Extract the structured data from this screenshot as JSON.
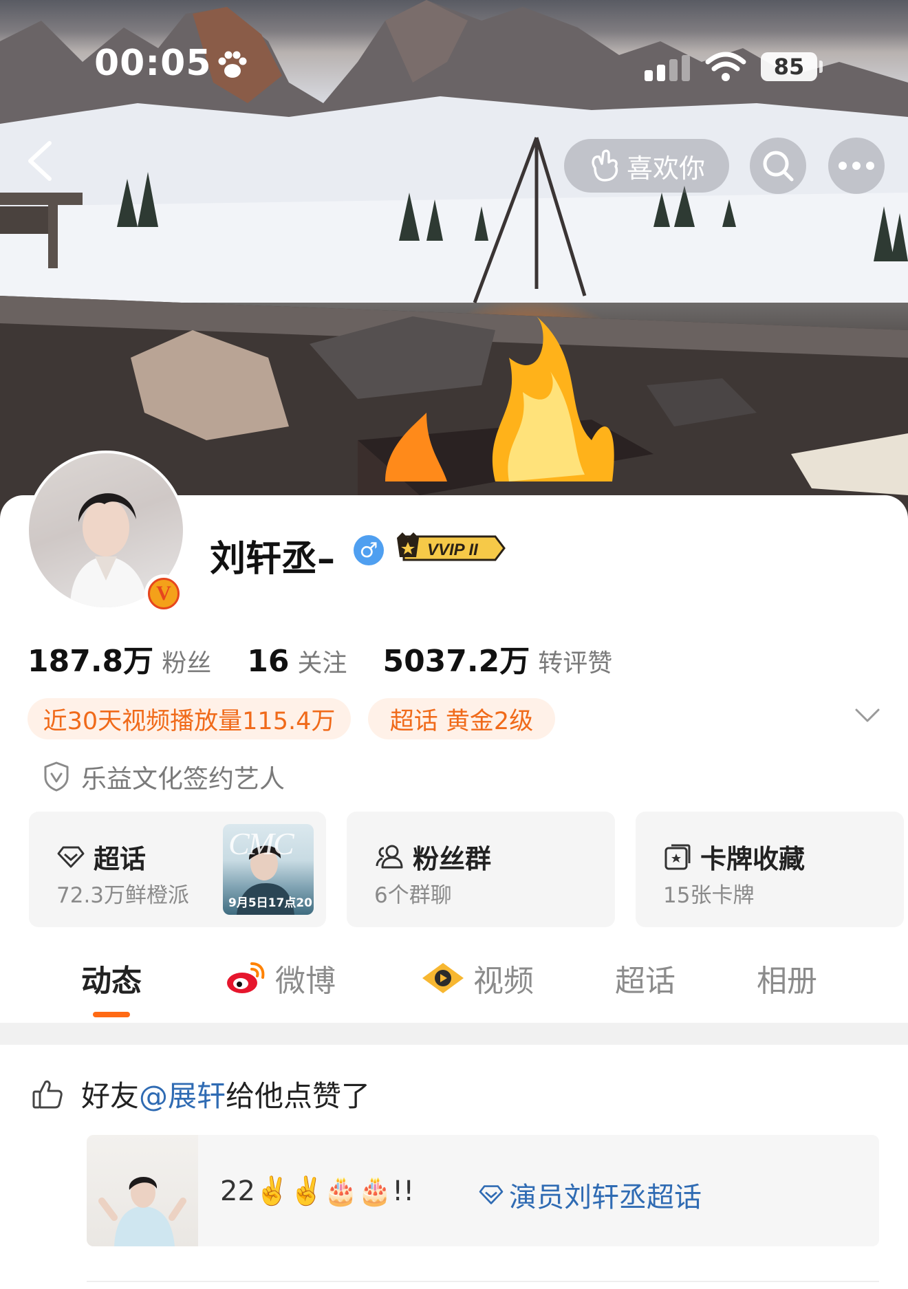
{
  "status_bar": {
    "time": "00:05",
    "battery": "85"
  },
  "nav": {
    "like_label": "喜欢你"
  },
  "profile": {
    "username": "刘轩丞–",
    "gender_symbol": "♂",
    "vip_label": "VVIP II",
    "verified_mark": "V"
  },
  "stats": [
    {
      "value": "187.8万",
      "label": "粉丝"
    },
    {
      "value": "16",
      "label": "关注"
    },
    {
      "value": "5037.2万",
      "label": "转评赞"
    }
  ],
  "tags": {
    "video_plays": "近30天视频播放量115.4万",
    "topic_level": "超话 黄金2级"
  },
  "contract_label": "乐益文化签约艺人",
  "cards": {
    "supertopic": {
      "title": "超话",
      "sub": "72.3万鲜橙派",
      "thumb_title": "CMC",
      "thumb_date": "9月5日17点20"
    },
    "fan_group": {
      "title": "粉丝群",
      "sub": "6个群聊"
    },
    "card_collection": {
      "title": "卡牌收藏",
      "sub": "15张卡牌"
    }
  },
  "tabs": [
    "动态",
    "微博",
    "视频",
    "超话",
    "相册"
  ],
  "feed": {
    "prefix": "好友",
    "mention": "@展轩",
    "suffix": "给他点赞了",
    "post_text": "22✌️✌️🎂🎂!!",
    "topic": "演员刘轩丞超话"
  },
  "colors": {
    "accent_orange": "#ff6a14",
    "link_blue": "#2f6bb3",
    "tag_bg": "#fff1e8",
    "tag_text": "#f06a1a"
  }
}
